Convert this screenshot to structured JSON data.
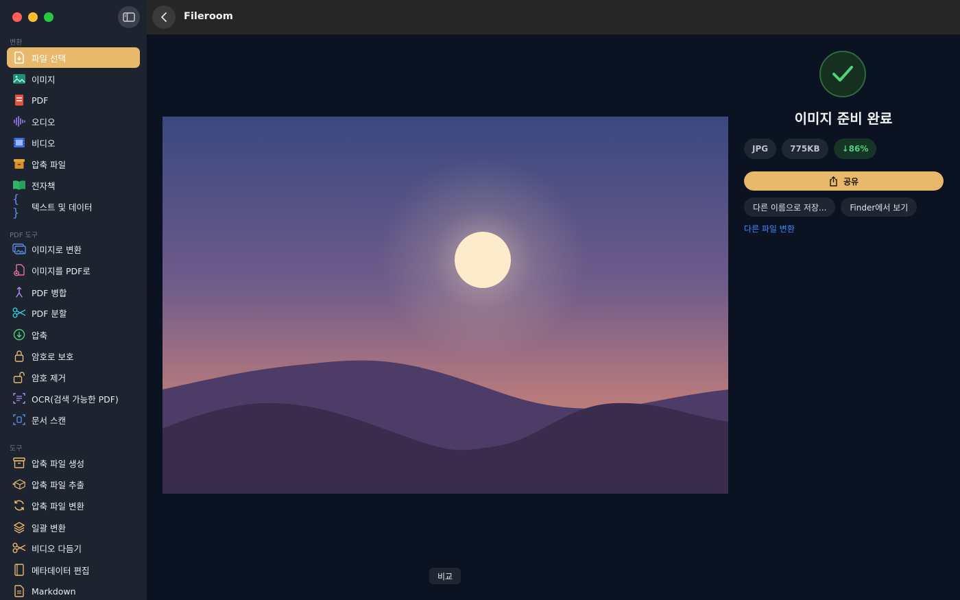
{
  "app": {
    "title": "Fileroom"
  },
  "sidebar": {
    "sections": [
      {
        "label": "변환",
        "items": [
          {
            "label": "파일 선택",
            "icon": "file-select-icon",
            "active": true
          },
          {
            "label": "이미지",
            "icon": "image-icon"
          },
          {
            "label": "PDF",
            "icon": "pdf-icon"
          },
          {
            "label": "오디오",
            "icon": "audio-waveform-icon"
          },
          {
            "label": "비디오",
            "icon": "film-icon"
          },
          {
            "label": "압축 파일",
            "icon": "archive-box-icon"
          },
          {
            "label": "전자책",
            "icon": "book-icon"
          },
          {
            "label": "텍스트 및 데이터",
            "icon": "braces-icon"
          }
        ]
      },
      {
        "label": "PDF 도구",
        "items": [
          {
            "label": "이미지로 변환",
            "icon": "images-icon"
          },
          {
            "label": "이미지를 PDF로",
            "icon": "file-plus-icon"
          },
          {
            "label": "PDF 병합",
            "icon": "merge-icon"
          },
          {
            "label": "PDF 분할",
            "icon": "scissors-icon"
          },
          {
            "label": "압축",
            "icon": "compress-down-icon"
          },
          {
            "label": "암호로 보호",
            "icon": "lock-icon"
          },
          {
            "label": "암호 제거",
            "icon": "unlock-icon"
          },
          {
            "label": "OCR(검색 가능한 PDF)",
            "icon": "text-scan-icon"
          },
          {
            "label": "문서 스캔",
            "icon": "doc-scan-icon"
          }
        ]
      },
      {
        "label": "도구",
        "items": [
          {
            "label": "압축 파일 생성",
            "icon": "archive-create-icon"
          },
          {
            "label": "압축 파일 추출",
            "icon": "archive-extract-icon"
          },
          {
            "label": "압축 파일 변환",
            "icon": "refresh-icon"
          },
          {
            "label": "일괄 변환",
            "icon": "stack-icon"
          },
          {
            "label": "비디오 다듬기",
            "icon": "trim-scissors-icon"
          },
          {
            "label": "메타데이터 편집",
            "icon": "metadata-book-icon"
          },
          {
            "label": "Markdown",
            "icon": "markdown-file-icon"
          }
        ]
      }
    ]
  },
  "result": {
    "title": "이미지 준비 완료",
    "format": "JPG",
    "size": "775KB",
    "reduction": "↓86%",
    "share_label": "공유",
    "save_as_label": "다른 이름으로 저장...",
    "finder_label": "Finder에서 보기",
    "convert_other_label": "다른 파일 변환"
  },
  "compare_label": "비교",
  "colors": {
    "accent": "#e8b96a",
    "success": "#4fd27a",
    "link": "#3d8bff"
  }
}
